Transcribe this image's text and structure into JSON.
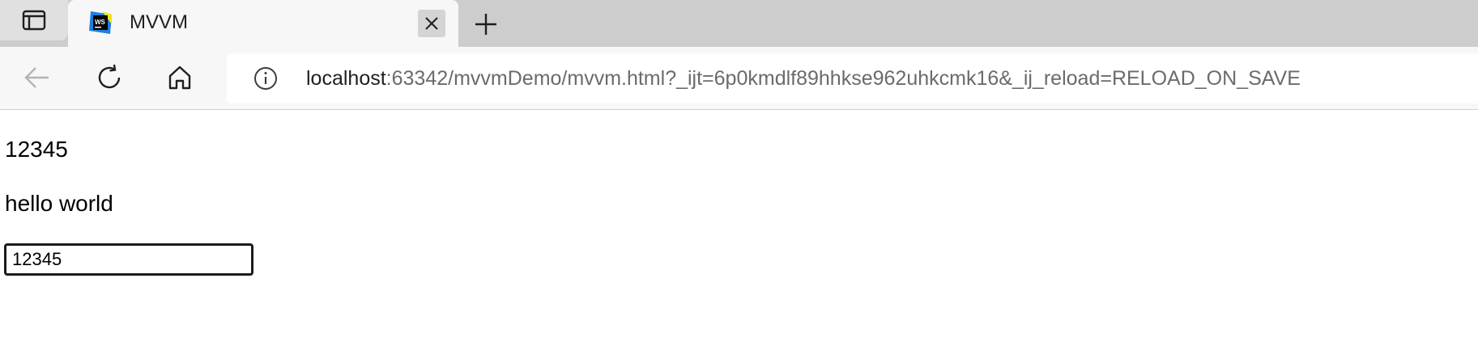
{
  "browser": {
    "tab": {
      "title": "MVVM",
      "favicon": "webstorm-icon"
    },
    "address": {
      "host": "localhost",
      "rest": ":63342/mvvmDemo/mvvm.html?_ijt=6p0kmdlf89hhkse962uhkcmk16&_ij_reload=RELOAD_ON_SAVE"
    }
  },
  "page": {
    "line1": "12345",
    "line2": "hello world",
    "input_value": "12345"
  },
  "colors": {
    "tabstrip": "#cdcdcd",
    "toolbar": "#f7f7f7",
    "webstorm_blue": "#1f7fe0",
    "webstorm_yellow": "#f5e21b"
  }
}
